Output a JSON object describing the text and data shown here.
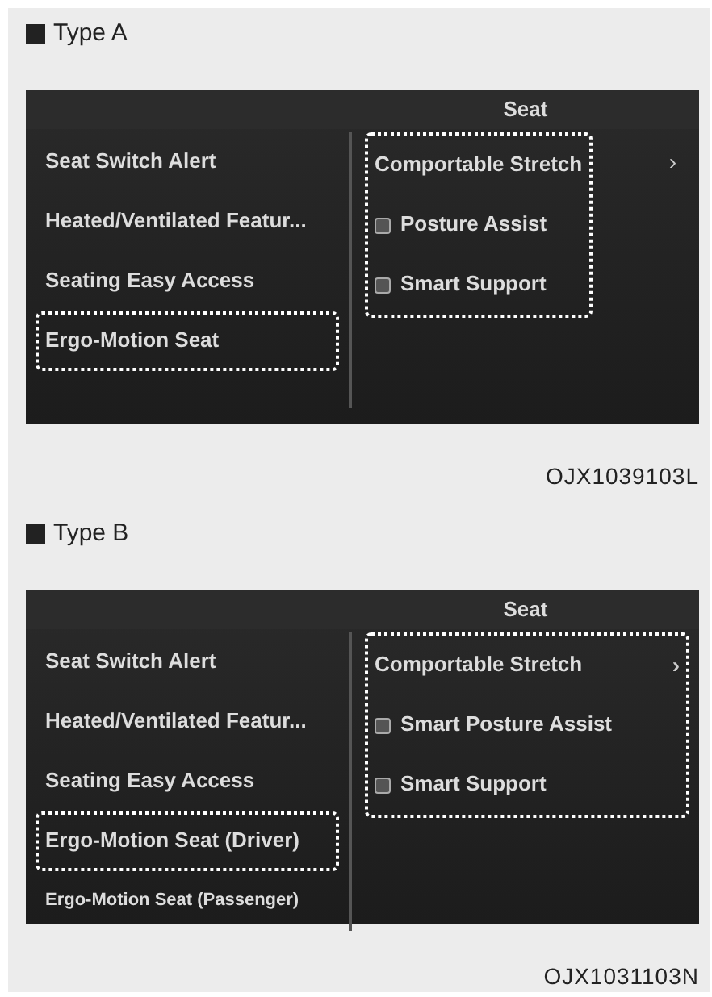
{
  "sections": [
    {
      "label": "Type A",
      "screen": {
        "title": "Seat",
        "menu": [
          {
            "text": "Seat Switch Alert",
            "highlighted": false,
            "small": false
          },
          {
            "text": "Heated/Ventilated Featur...",
            "highlighted": false,
            "small": false
          },
          {
            "text": "Seating Easy Access",
            "highlighted": false,
            "small": false
          },
          {
            "text": "Ergo-Motion Seat",
            "highlighted": true,
            "small": false
          }
        ],
        "frame_includes_arrow": false,
        "options": [
          {
            "kind": "link",
            "text": "Comportable Stretch",
            "arrow": "›"
          },
          {
            "kind": "checkbox",
            "text": "Posture Assist",
            "checked": true
          },
          {
            "kind": "checkbox",
            "text": "Smart Support",
            "checked": true
          }
        ]
      },
      "code": "OJX1039103L"
    },
    {
      "label": "Type B",
      "screen": {
        "title": "Seat",
        "menu": [
          {
            "text": "Seat Switch Alert",
            "highlighted": false,
            "small": false
          },
          {
            "text": "Heated/Ventilated Featur...",
            "highlighted": false,
            "small": false
          },
          {
            "text": "Seating Easy Access",
            "highlighted": false,
            "small": false
          },
          {
            "text": "Ergo-Motion Seat (Driver)",
            "highlighted": true,
            "small": false
          },
          {
            "text": "Ergo-Motion Seat (Passenger)",
            "highlighted": false,
            "small": true
          }
        ],
        "frame_includes_arrow": true,
        "options": [
          {
            "kind": "link",
            "text": "Comportable Stretch",
            "arrow": "›"
          },
          {
            "kind": "checkbox",
            "text": "Smart Posture Assist",
            "checked": true
          },
          {
            "kind": "checkbox",
            "text": "Smart Support",
            "checked": true
          }
        ]
      },
      "code": "OJX1031103N"
    }
  ]
}
